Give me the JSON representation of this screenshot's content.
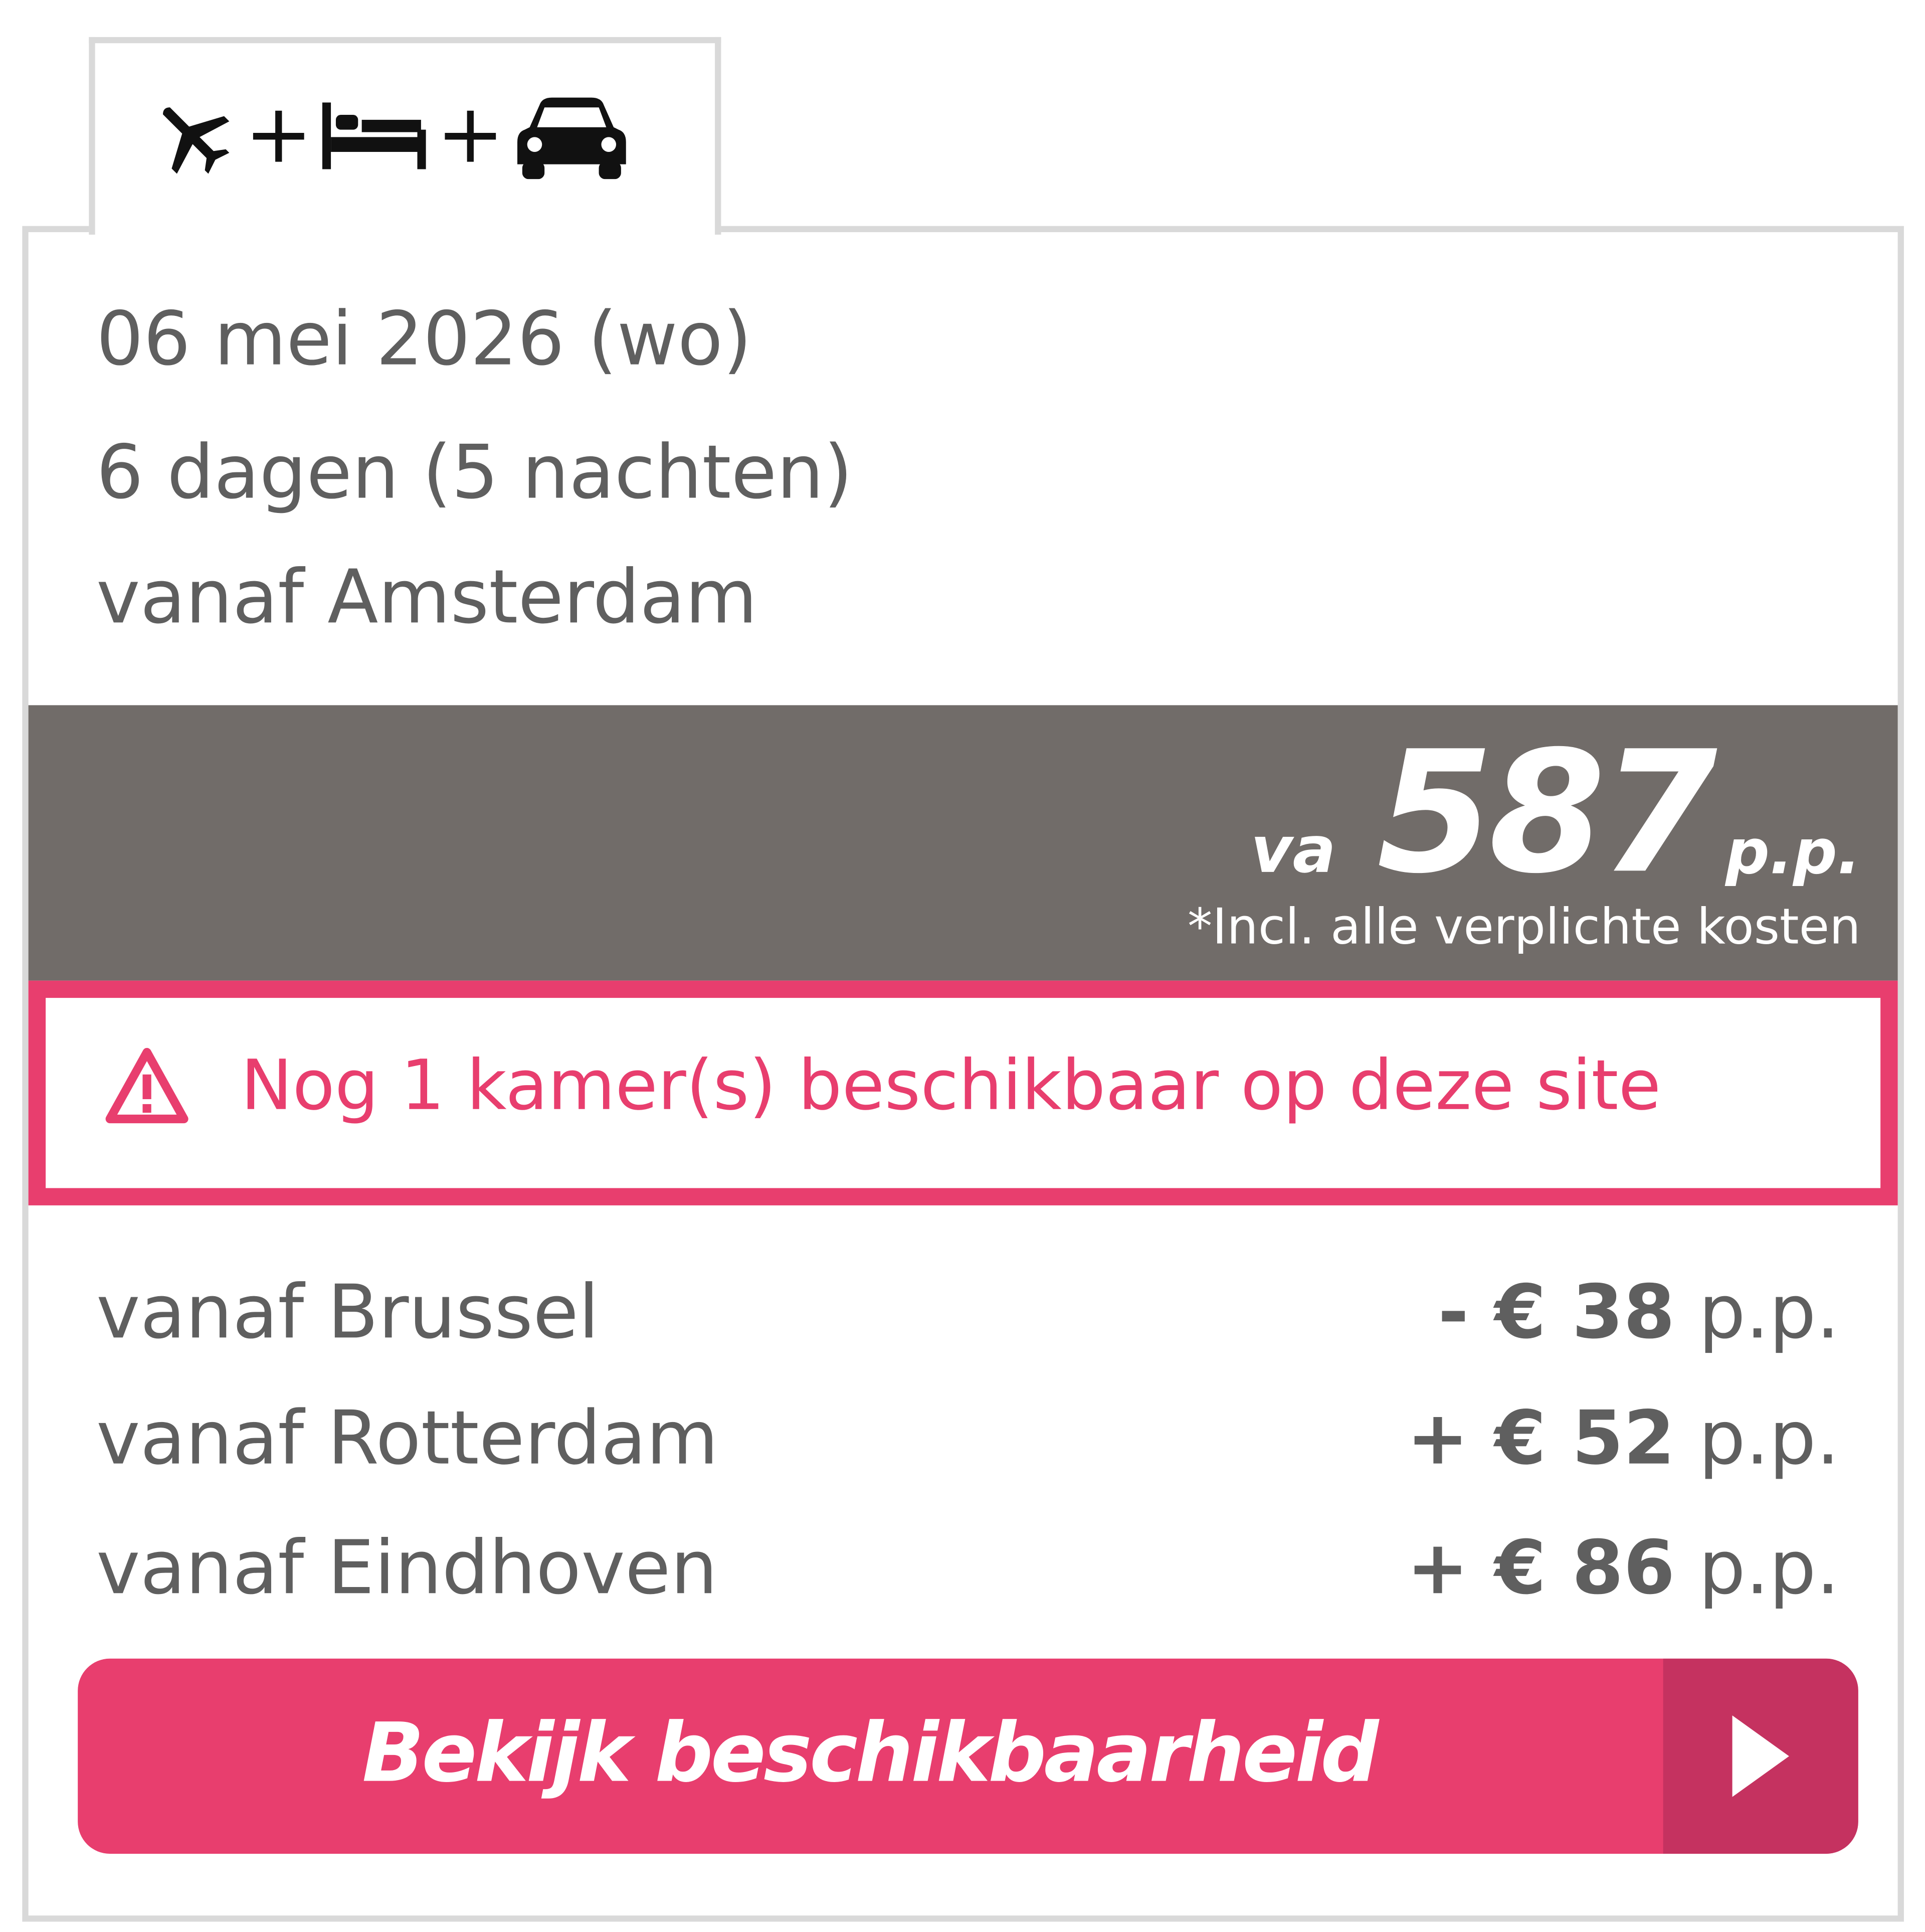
{
  "tab": {
    "icons": [
      "plane-icon",
      "bed-icon",
      "car-icon"
    ],
    "plus_1": "+",
    "plus_2": "+"
  },
  "trip": {
    "date": "06 mei 2026 (wo)",
    "duration": "6 dagen (5 nachten)",
    "departure": "vanaf Amsterdam"
  },
  "price": {
    "prefix": "va",
    "amount": "587",
    "suffix": "p.p.",
    "note": "*Incl. alle verplichte kosten"
  },
  "alert": {
    "icon": "warning-icon",
    "text": "Nog 1 kamer(s) beschikbaar op deze site"
  },
  "alternatives": [
    {
      "label": "vanaf Brussel",
      "sign": "-",
      "amount": "€ 38",
      "unit": "p.p."
    },
    {
      "label": "vanaf Rotterdam",
      "sign": "+",
      "amount": "€ 52",
      "unit": "p.p."
    },
    {
      "label": "vanaf Eindhoven",
      "sign": "+",
      "amount": "€ 86",
      "unit": "p.p."
    }
  ],
  "cta": {
    "label": "Bekijk beschikbaarheid",
    "icon": "play-arrow-icon"
  },
  "colors": {
    "accent": "#e83e6e",
    "accent_dark": "#c53260",
    "price_band": "#716c69",
    "text": "#5f5f5f",
    "border": "#d9d9d9"
  }
}
